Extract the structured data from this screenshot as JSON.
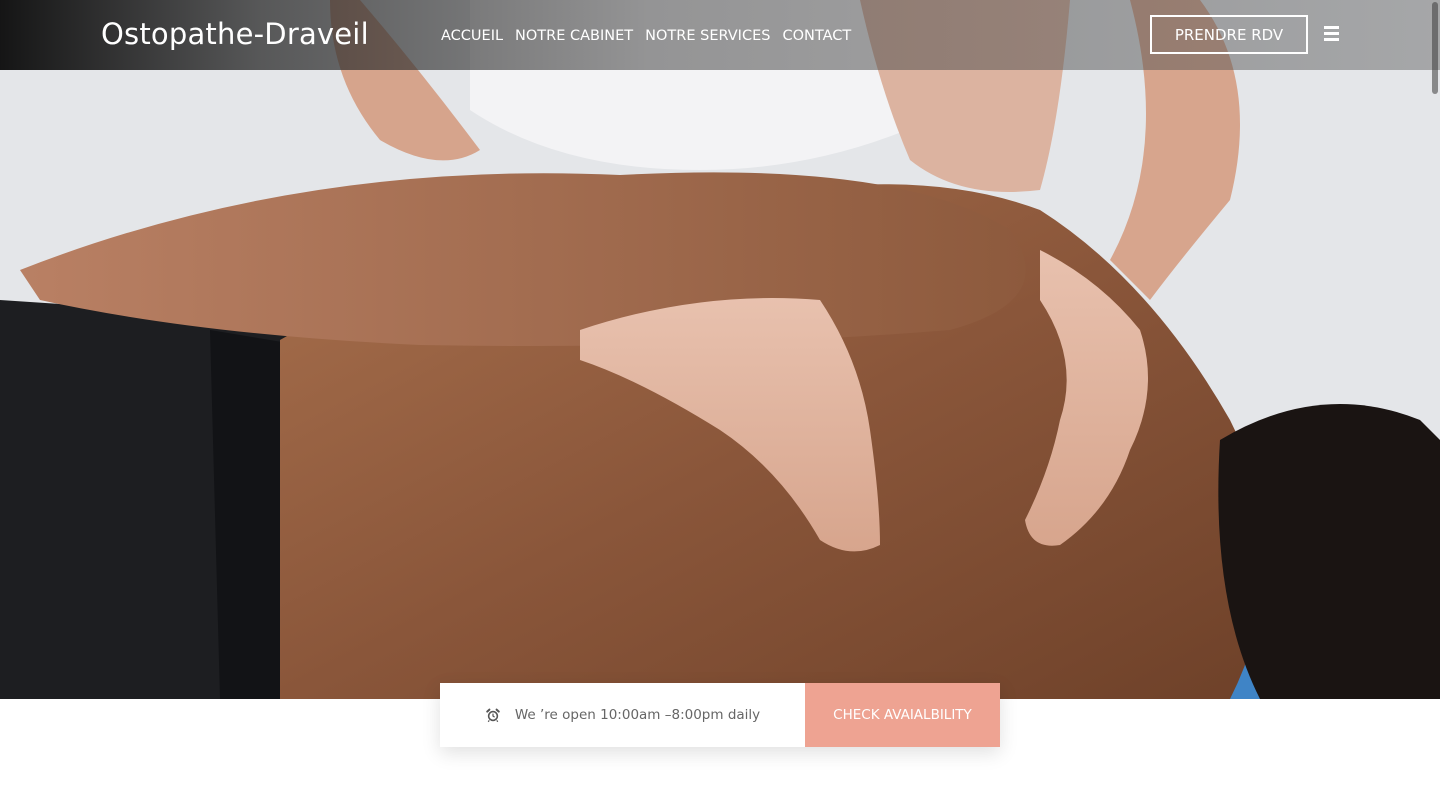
{
  "header": {
    "brand": "Ostopathe-Draveil",
    "nav": [
      {
        "label": "ACCUEIL"
      },
      {
        "label": "NOTRE CABINET"
      },
      {
        "label": "NOTRE SERVICES"
      },
      {
        "label": "CONTACT"
      }
    ],
    "cta_label": "PRENDRE RDV",
    "menu_icon": "hamburger-icon"
  },
  "hero": {
    "image_subject": "massage-photo"
  },
  "availability": {
    "icon": "alarm-clock-icon",
    "hours_text": "We ’re open 10:00am –8:00pm daily",
    "button_label": "CHECK AVAIALBILITY"
  },
  "colors": {
    "accent": "#eea392",
    "text_light": "#ffffff",
    "text_muted": "#666666"
  }
}
